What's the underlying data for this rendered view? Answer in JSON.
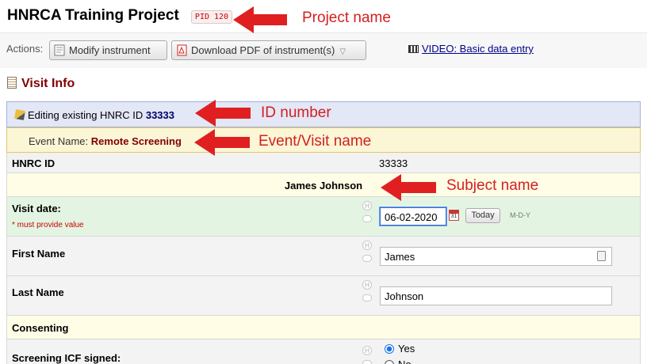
{
  "header": {
    "project_title": "HNRCA Training Project",
    "pid_badge": "PID 120"
  },
  "actions": {
    "label": "Actions:",
    "modify_button": "Modify instrument",
    "pdf_button": "Download PDF of instrument(s)",
    "video_link": "VIDEO: Basic data entry"
  },
  "section": {
    "title": "Visit Info"
  },
  "form": {
    "editing_prefix": "Editing existing HNRC ID",
    "record_id": "33333",
    "event_prefix": "Event Name:",
    "event_name": "Remote Screening",
    "id_label": "HNRC ID",
    "id_value": "33333",
    "subject_name": "James Johnson",
    "visit_date_label": "Visit date:",
    "visit_date_required": "* must provide value",
    "visit_date_value": "06-02-2020",
    "today_button": "Today",
    "date_format": "M-D-Y",
    "first_name_label": "First Name",
    "first_name_value": "James",
    "last_name_label": "Last Name",
    "last_name_value": "Johnson",
    "consenting_header": "Consenting",
    "icf_label": "Screening ICF signed:",
    "icf_options": [
      "Yes",
      "No"
    ],
    "icf_selected": "Yes",
    "help_icon_glyph": "H",
    "calendar_day": "31"
  },
  "annotations": {
    "project_name": "Project name",
    "id_number": "ID number",
    "event_visit_name": "Event/Visit name",
    "subject_name": "Subject name"
  },
  "colors": {
    "annotation_red": "#d42020",
    "title_maroon": "#800000",
    "edit_bar": "#e3e7f6",
    "event_bar": "#fbf6d6",
    "required_row": "#e3f5e2"
  }
}
